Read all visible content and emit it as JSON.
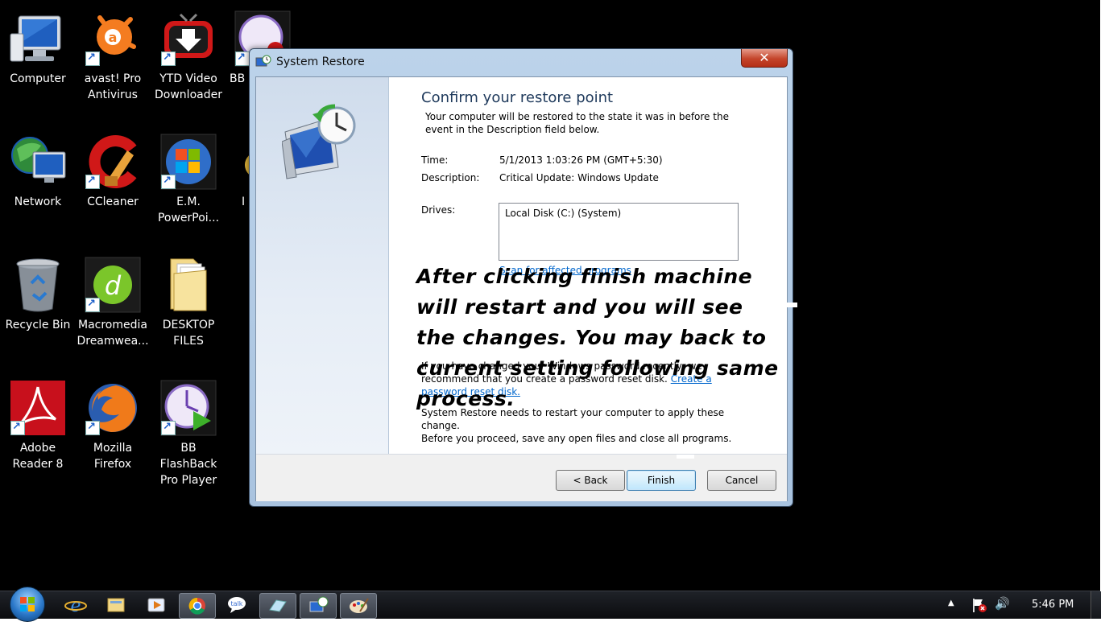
{
  "desktop": {
    "icons": [
      {
        "label": "Computer"
      },
      {
        "label": "avast! Pro Antivirus"
      },
      {
        "label": "YTD Video Downloader"
      },
      {
        "label": "BB Pro"
      },
      {
        "label": "Network"
      },
      {
        "label": "CCleaner"
      },
      {
        "label": "E.M. PowerPoi..."
      },
      {
        "label": "I E"
      },
      {
        "label": "Recycle Bin"
      },
      {
        "label": "Macromedia Dreamwea..."
      },
      {
        "label": "DESKTOP FILES"
      },
      {
        "label": "Adobe Reader 8"
      },
      {
        "label": "Mozilla Firefox"
      },
      {
        "label": "BB FlashBack Pro Player"
      }
    ]
  },
  "window": {
    "title": "System Restore",
    "close_glyph": "✕",
    "heading": "Confirm your restore point",
    "intro": "Your computer will be restored to the state it was in before the event in the Description field below.",
    "time_label": "Time:",
    "time_value": "5/1/2013 1:03:26 PM (GMT+5:30)",
    "description_label": "Description:",
    "description_value": "Critical Update: Windows Update",
    "drives_label": "Drives:",
    "drives_value": "Local Disk (C:) (System)",
    "scan_link": "Scan for affected programs",
    "password_text": "If you have changed your Windows password recently, we recommend that you create a password reset disk.",
    "password_link": "Create a password reset disk.",
    "restart_text": "System Restore needs to restart your computer to apply these change.\nBefore you proceed, save any open files and close all programs.",
    "buttons": {
      "back": "< Back",
      "finish": "Finish",
      "cancel": "Cancel"
    }
  },
  "annotation": {
    "text": "After clicking finish machine will restart and you will see the changes. You may back to current setting following same process."
  },
  "taskbar": {
    "clock": "5:46 PM",
    "up_arrow": "▲",
    "speaker_glyph": "🔊"
  },
  "colors": {
    "desktop_bg": "#000000",
    "heading_blue": "#1e395b",
    "link_blue": "#0066cc",
    "close_red": "#c4442a"
  }
}
